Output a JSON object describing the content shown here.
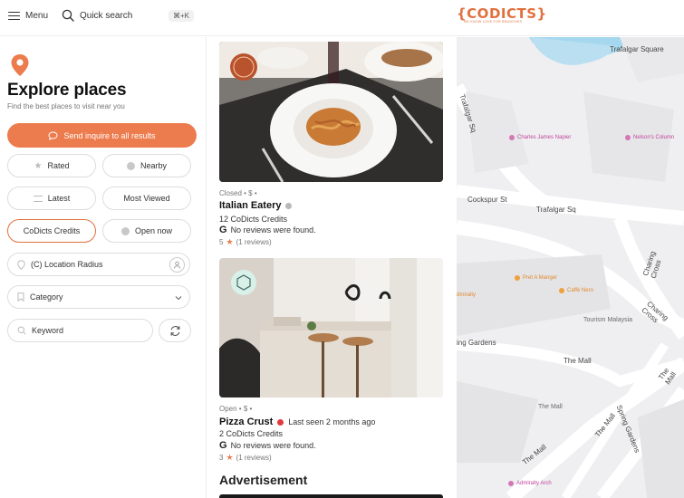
{
  "header": {
    "menu_label": "Menu",
    "search_label": "Quick search",
    "shortcut": "⌘+K",
    "logo_text": "{CODICTS}",
    "logo_tagline": "WE KNOW LOVE FOR BRUNCHES"
  },
  "sidebar": {
    "title": "Explore places",
    "subtitle": "Find the best places to visit near you",
    "inquire_button": "Send inquire to all results",
    "filters": {
      "rated": "Rated",
      "nearby": "Nearby",
      "latest": "Latest",
      "most_viewed": "Most Viewed",
      "credits": "CoDicts Credits",
      "open_now": "Open now"
    },
    "location_placeholder": "(C) Location Radius",
    "category_placeholder": "Category",
    "keyword_placeholder": "Keyword"
  },
  "listings": [
    {
      "status_line": "Closed • $ •",
      "name": "Italian Eatery",
      "credits": "12 CoDicts Credits",
      "reviews": "No reviews were found.",
      "rating": "5",
      "rating_count": "(1 reviews)",
      "status_color": "#b8b8b8",
      "last_seen": ""
    },
    {
      "status_line": "Open • $ •",
      "name": "Pizza Crust",
      "credits": "2 CoDicts Credits",
      "reviews": "No reviews were found.",
      "rating": "3",
      "rating_count": "(1 reviews)",
      "status_color": "#e23b3b",
      "last_seen": "Last seen 2 months ago"
    }
  ],
  "advertisement_heading": "Advertisement",
  "map": {
    "streets": [
      "Trafalgar Square",
      "Trafalgar Sq",
      "Cockspur St",
      "Trafalgar Sq",
      "Charing Cross",
      "Charing Cross",
      "Spring Gardens",
      "The Mall",
      "The Mall",
      "The Mall",
      "The Mall",
      "ing Gardens"
    ],
    "places": [
      "Charles James Napier",
      "Nelson's Column",
      "Pret A Manger",
      "Caffè Nero",
      "Tourism Malaysia",
      "dmiralty",
      "The Mall",
      "Admiralty Arch"
    ]
  },
  "colors": {
    "accent": "#ec7c4d",
    "accent_border": "#e0713f"
  }
}
